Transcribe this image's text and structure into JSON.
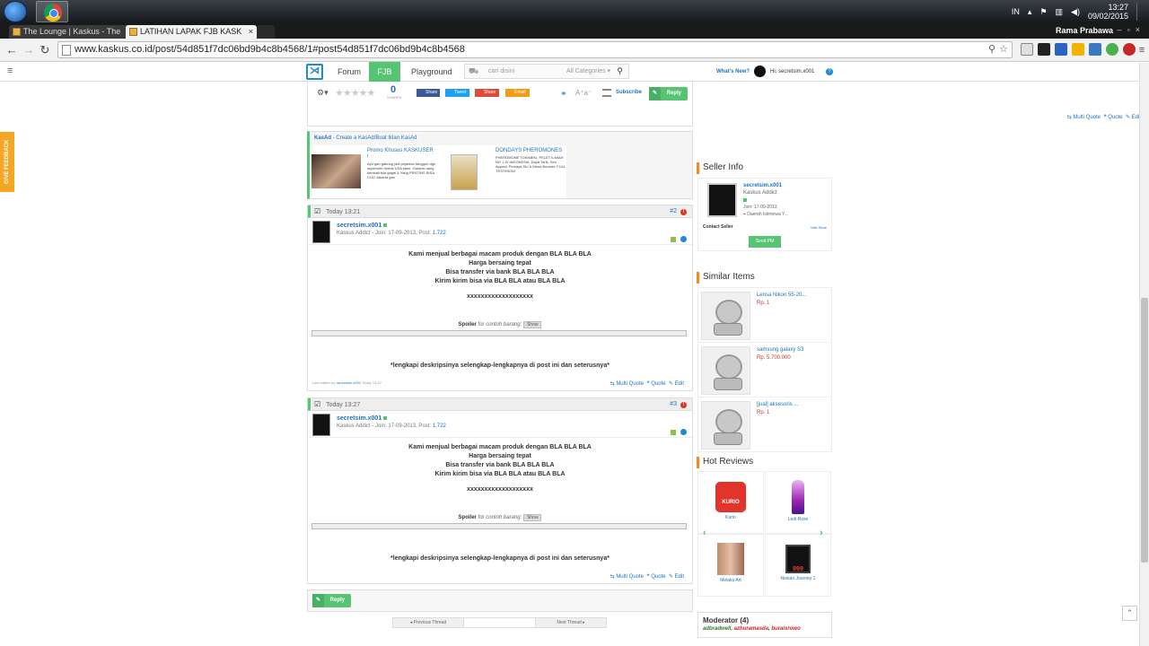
{
  "taskbar": {
    "ime": "IN",
    "time": "13:27",
    "date": "09/02/2015"
  },
  "tabs": [
    {
      "label": "The Lounge | Kaskus - The"
    },
    {
      "label": "LATIHAN LAPAK FJB KASK"
    }
  ],
  "browser": {
    "user": "Rama Prabawa",
    "url": "www.kaskus.co.id/post/54d851f7dc06bd9b4c8b4568/1#post54d851f7dc06bd9b4c8b4568"
  },
  "nav": {
    "forum": "Forum",
    "fjb": "FJB",
    "playground": "Playground",
    "search_placeholder": "cari disini",
    "categories": "All Categories",
    "whats_new": "What's New?",
    "greeting": "Hi, secretsim.x001"
  },
  "feedback": "GIVE FEEDBACK",
  "toppost": {
    "shares_count": "0",
    "shares_label": "SHARES",
    "share_fb": "Share",
    "share_tw": "Tweet",
    "share_gp": "Share",
    "share_email": "Email",
    "subscribe": "Subscribe",
    "reply": "Reply",
    "multi_quote": "Multi Quote",
    "quote": "Quote",
    "edit": "Edit"
  },
  "kasad": {
    "title": "KasAd",
    "link": "Create a KasAd/Buat Iklan KasAd",
    "ad1_title": "Promo Khusus KASKUSER !",
    "ad1_text": "Ayo gan gabung jadi pejantan tangguh dgn suplemen herbal USA kami. Garansi uang kembali bila gagal & Yang PENTING BISA COD Jakarta gan",
    "ad2_title": "DONDAYS PHEROMONES",
    "ad2_text": "PHEROMONE TOKIMEKI, PELET ILMIAH NO 1 DI INDONESIA, Daya Tarik, Sex Appeal, Percaya Diri & Mood Booster, FULL TESTIMONI"
  },
  "posts": [
    {
      "time": "Today 13:21",
      "number": "#2",
      "username": "secretsim.x001",
      "meta_rank": "Kaskus Addict",
      "meta_join": "Join: 17-09-2013",
      "meta_posts_label": "Post:",
      "meta_posts": "1,722",
      "line1": "Kami menjual berbagai macam produk dengan BLA BLA BLA",
      "line2": "Harga bersaing tepat",
      "line3": "Bisa transfer via bank BLA BLA BLA",
      "line4": "Kirim kirim bisa via BLA BLA atau BLA BLA",
      "line5": "xxxxxxxxxxxxxxxxxxx",
      "spoiler_label": "Spoiler",
      "spoiler_for": "for",
      "spoiler_title": "contoh barang:",
      "show": "Show",
      "footer_text": "*lengkapi deskripsinya selengkap-lengkapnya di post ini dan seterusnya*",
      "last_edited_label": "Last edited by:",
      "last_edited_user": "secretsim.x001",
      "last_edited_time": "Today 13:22",
      "multi_quote": "Multi Quote",
      "quote": "Quote",
      "edit": "Edit"
    },
    {
      "time": "Today 13:27",
      "number": "#3",
      "username": "secretsim.x001",
      "meta_rank": "Kaskus Addict",
      "meta_join": "Join: 17-09-2013",
      "meta_posts_label": "Post:",
      "meta_posts": "1,722",
      "line1": "Kami menjual berbagai macam produk dengan BLA BLA BLA",
      "line2": "Harga bersaing tepat",
      "line3": "Bisa transfer via bank BLA BLA BLA",
      "line4": "Kirim kirim bisa via BLA BLA atau BLA BLA",
      "line5": "xxxxxxxxxxxxxxxxxxx",
      "spoiler_label": "Spoiler",
      "spoiler_for": "for",
      "spoiler_title": "contoh barang:",
      "show": "Show",
      "footer_text": "*lengkapi deskripsinya selengkap-lengkapnya di post ini dan seterusnya*",
      "multi_quote": "Multi Quote",
      "quote": "Quote",
      "edit": "Edit"
    }
  ],
  "bottom": {
    "reply": "Reply",
    "prev": "Previous Thread",
    "next": "Next Thread"
  },
  "seller": {
    "heading": "Seller Info",
    "username": "secretsim.x001",
    "rank": "Kaskus Addict",
    "join": "Join: 17-09-2013",
    "location": "Daerah Istimewa Y...",
    "contact": "Contact Seller",
    "visit": "Visit Store",
    "send_pm": "Send PM"
  },
  "similar": {
    "heading": "Similar Items",
    "items": [
      {
        "title": "Lensa Nikon 55-20...",
        "price": "Rp. 1"
      },
      {
        "title": "samsung galaxy S3",
        "price": "Rp. 5.700.000"
      },
      {
        "title": "[jual] aksesoris ...",
        "price": "Rp. 1"
      }
    ]
  },
  "reviews": {
    "heading": "Hot Reviews",
    "items": [
      {
        "label": "Kurio"
      },
      {
        "label": "Ledi Rose"
      },
      {
        "label": "Melaku Art"
      },
      {
        "label": "Nexian Journey 1"
      }
    ]
  },
  "moderator": {
    "heading": "Moderator (4)",
    "names": [
      "adbradwell",
      "azhuramasda",
      "buraisrowo"
    ]
  },
  "colors": {
    "accent_green": "#57c474",
    "accent_orange": "#f28a1d",
    "link_blue": "#1e73be"
  }
}
